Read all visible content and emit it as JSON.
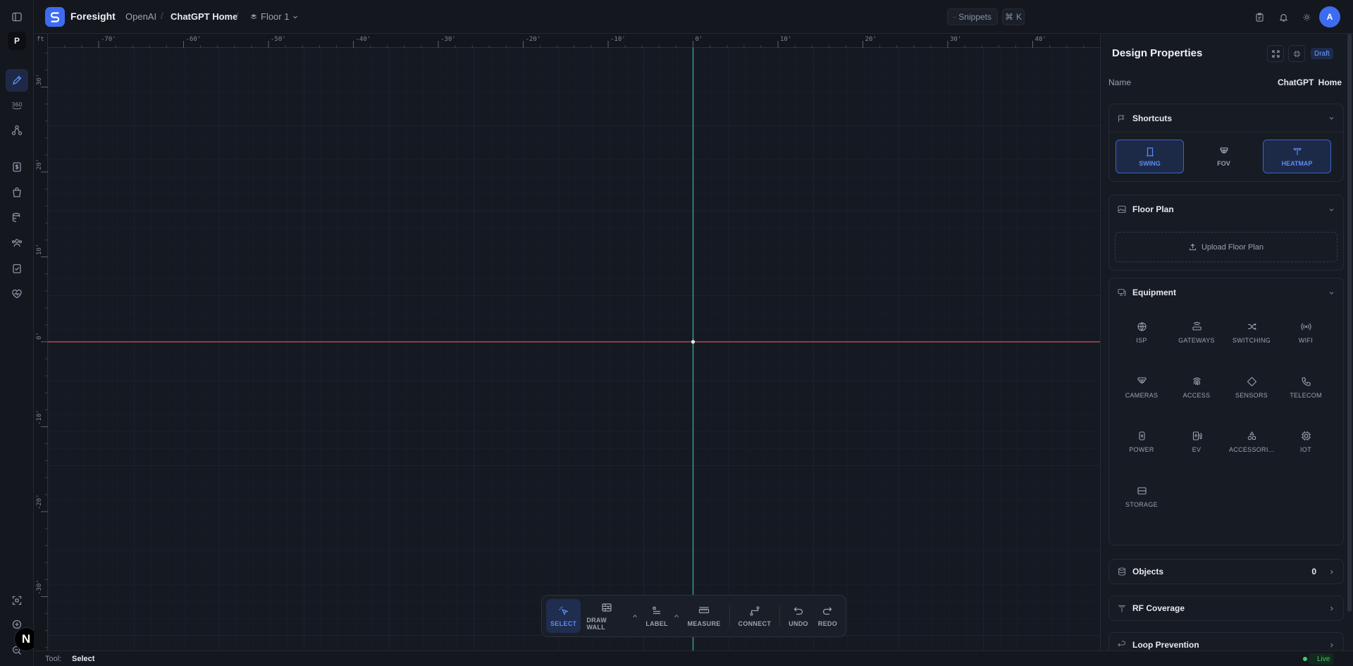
{
  "header": {
    "brand": "Foresight",
    "breadcrumb": [
      "OpenAI",
      "ChatGPT Home"
    ],
    "floor": "Floor 1",
    "snippets": "Snippets",
    "shortcut_key": "K",
    "avatar": "A"
  },
  "rail": {
    "project_initial": "P",
    "bottom_initial": "N"
  },
  "canvas": {
    "unit": "ft",
    "x_ticks": [
      "-70'",
      "-60'",
      "-50'",
      "-40'",
      "-30'",
      "-20'",
      "-10'",
      "0'",
      "10'",
      "20'",
      "30'",
      "40'"
    ],
    "y_ticks": [
      "30'",
      "20'",
      "10'",
      "0'",
      "-10'",
      "-20'",
      "-30'"
    ]
  },
  "toolbar": {
    "tools": [
      "SELECT",
      "DRAW WALL",
      "LABEL",
      "MEASURE",
      "CONNECT",
      "UNDO",
      "REDO"
    ]
  },
  "status": {
    "tool_label": "Tool:",
    "tool_value": "Select",
    "live": "Live"
  },
  "panel": {
    "title": "Design Properties",
    "badge": "Draft",
    "name_label": "Name",
    "name_value": "ChatGPT Home",
    "shortcuts": {
      "title": "Shortcuts",
      "items": [
        {
          "label": "SWING",
          "active": true
        },
        {
          "label": "FOV",
          "active": false
        },
        {
          "label": "HEATMAP",
          "active": true
        }
      ]
    },
    "floor_plan": {
      "title": "Floor Plan",
      "upload": "Upload Floor Plan"
    },
    "equipment": {
      "title": "Equipment",
      "items": [
        "ISP",
        "GATEWAYS",
        "SWITCHING",
        "WIFI",
        "CAMERAS",
        "ACCESS",
        "SENSORS",
        "TELECOM",
        "POWER",
        "EV",
        "ACCESSORI...",
        "IOT",
        "STORAGE"
      ]
    },
    "objects": {
      "title": "Objects",
      "count": "0"
    },
    "rf_coverage": {
      "title": "RF Coverage"
    },
    "loop_prevention": {
      "title": "Loop Prevention"
    }
  },
  "colors": {
    "accent": "#3e6cf0",
    "x_axis": "#b3484f",
    "y_axis": "#2fa58a",
    "live": "#3ed06f"
  }
}
